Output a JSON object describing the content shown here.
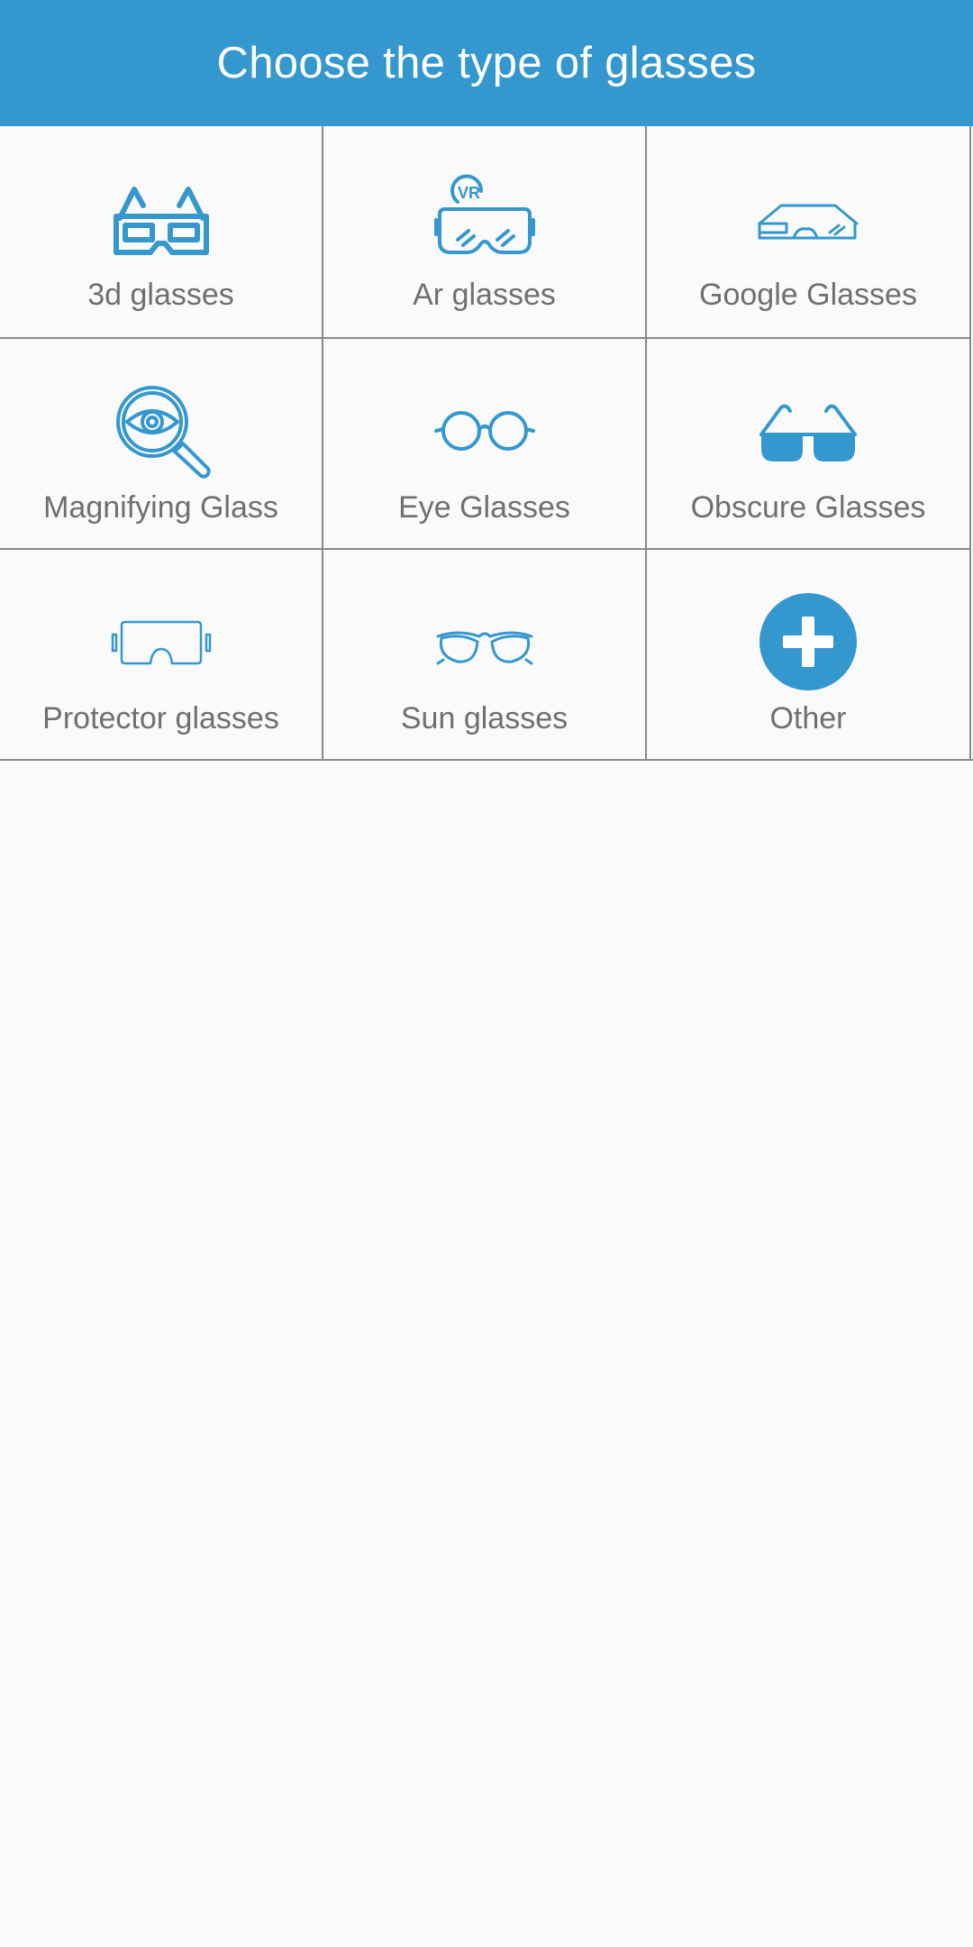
{
  "header": {
    "title": "Choose the type of glasses"
  },
  "colors": {
    "accent": "#3498cf",
    "label": "#6f6f6f",
    "divider": "#8a8a8a"
  },
  "grid": {
    "items": [
      {
        "label": "3d glasses",
        "icon": "3d-glasses-icon"
      },
      {
        "label": "Ar glasses",
        "icon": "vr-headset-icon"
      },
      {
        "label": "Google Glasses",
        "icon": "google-glass-icon"
      },
      {
        "label": "Magnifying Glass",
        "icon": "magnifying-glass-eye-icon"
      },
      {
        "label": "Eye Glasses",
        "icon": "round-eyeglasses-icon"
      },
      {
        "label": "Obscure Glasses",
        "icon": "dark-sunglasses-icon"
      },
      {
        "label": "Protector glasses",
        "icon": "safety-goggles-icon"
      },
      {
        "label": "Sun glasses",
        "icon": "aviator-sunglasses-icon"
      },
      {
        "label": "Other",
        "icon": "plus-circle-icon"
      }
    ]
  }
}
